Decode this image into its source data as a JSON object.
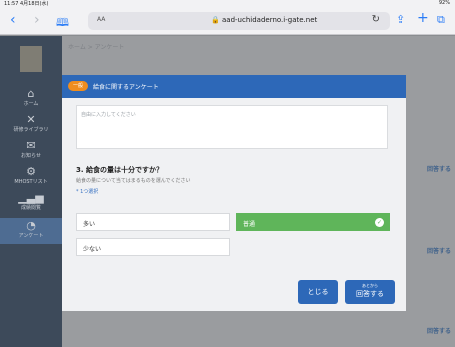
{
  "status_bar": {
    "time": "11:57 4月18日(水)",
    "battery": "92%"
  },
  "browser": {
    "text_size_label": "AA",
    "url": "aad-uchidaderno.i-gate.net",
    "back_icon": "chevron-left-icon",
    "forward_icon": "chevron-right-icon",
    "bookmarks_icon": "book-icon",
    "reload_icon": "reload-icon",
    "share_icon": "share-icon",
    "new_tab_icon": "plus-icon",
    "tabs_icon": "tabs-icon"
  },
  "sidebar": {
    "items": [
      {
        "icon": "home-icon",
        "label": "ホーム"
      },
      {
        "icon": "tools-icon",
        "label": "研修ライブラリ"
      },
      {
        "icon": "mail-icon",
        "label": "お知らせ"
      },
      {
        "icon": "gear-icon",
        "label": "MHOSTリスト"
      },
      {
        "icon": "chart-icon",
        "label": "成績閲覧"
      },
      {
        "icon": "pie-icon",
        "label": "アンケート"
      }
    ]
  },
  "page": {
    "breadcrumb": "ホーム > アンケート",
    "answer_labels": [
      "回答する",
      "回答する",
      "回答する"
    ]
  },
  "modal": {
    "badge": "一般",
    "title": "給食に関するアンケート",
    "textarea_placeholder": "自由に入力してください",
    "question": {
      "title": "3. 給食の量は十分ですか？",
      "description": "給食の量について当てはまるものを選んでください",
      "required_mark": "* 1つ選択"
    },
    "options": [
      {
        "label": "多い",
        "selected": false
      },
      {
        "label": "普通",
        "selected": true
      },
      {
        "label": "少ない",
        "selected": false
      }
    ],
    "close_label": "とじる",
    "answer_sub": "あとから",
    "answer_label": "回答する"
  },
  "colors": {
    "modal_header": "#2d68b8",
    "badge": "#ef8d1e",
    "selected_option": "#5fb55a",
    "sidebar": "#3d4a5a"
  }
}
